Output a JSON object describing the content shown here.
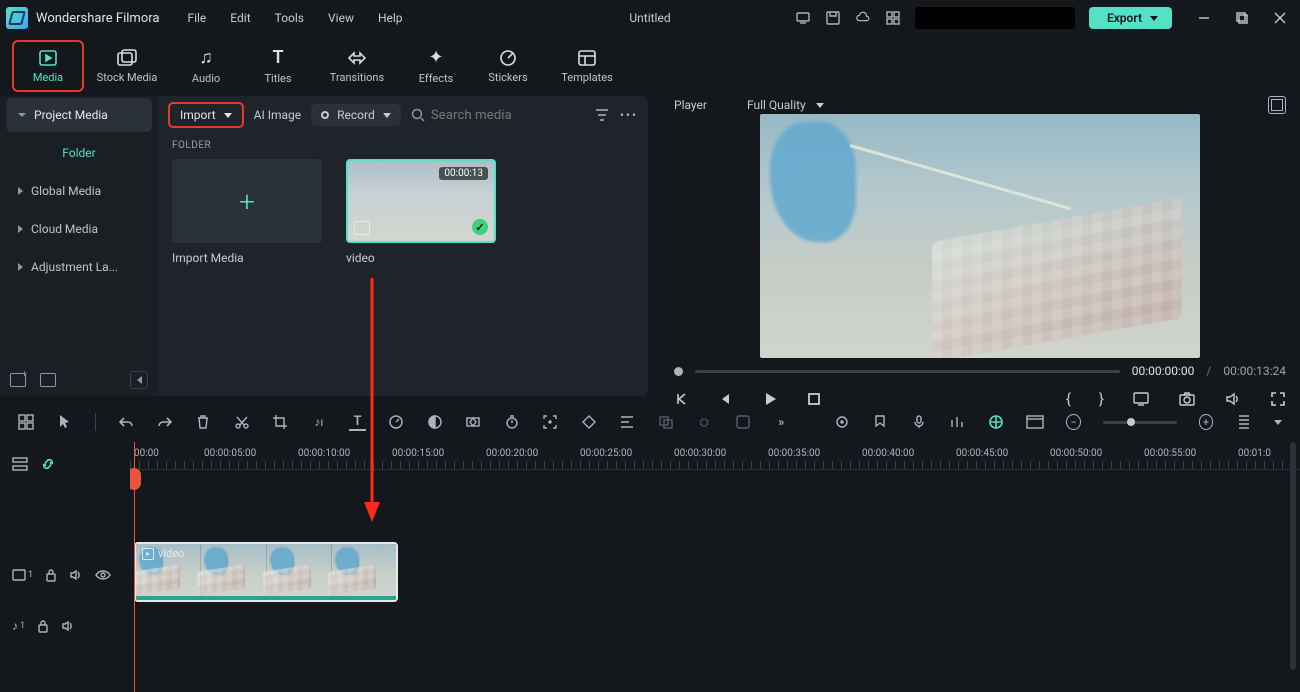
{
  "app_title": "Wondershare Filmora",
  "menu": [
    "File",
    "Edit",
    "Tools",
    "View",
    "Help"
  ],
  "doc_title": "Untitled",
  "export_label": "Export",
  "tabs": [
    {
      "label": "Media"
    },
    {
      "label": "Stock Media"
    },
    {
      "label": "Audio"
    },
    {
      "label": "Titles"
    },
    {
      "label": "Transitions"
    },
    {
      "label": "Effects"
    },
    {
      "label": "Stickers"
    },
    {
      "label": "Templates"
    }
  ],
  "sidebar": [
    {
      "label": "Project Media"
    },
    {
      "label": "Folder"
    },
    {
      "label": "Global Media"
    },
    {
      "label": "Cloud Media"
    },
    {
      "label": "Adjustment La..."
    }
  ],
  "media": {
    "import_label": "Import",
    "ai_image": "AI Image",
    "record": "Record",
    "search_ph": "Search media",
    "folder_hdr": "FOLDER",
    "slots": [
      {
        "caption": "Import Media"
      },
      {
        "caption": "video",
        "duration": "00:00:13"
      }
    ]
  },
  "player": {
    "title": "Player",
    "quality": "Full Quality",
    "current": "00:00:00:00",
    "duration": "00:00:13:24"
  },
  "timeline": {
    "ticks": [
      "00:00",
      "00:00:05:00",
      "00:00:10:00",
      "00:00:15:00",
      "00:00:20:00",
      "00:00:25:00",
      "00:00:30:00",
      "00:00:35:00",
      "00:00:40:00",
      "00:00:45:00",
      "00:00:50:00",
      "00:00:55:00",
      "00:01:0"
    ],
    "clip_label": "video",
    "video_track_badge": "1",
    "audio_track_badge": "1"
  }
}
